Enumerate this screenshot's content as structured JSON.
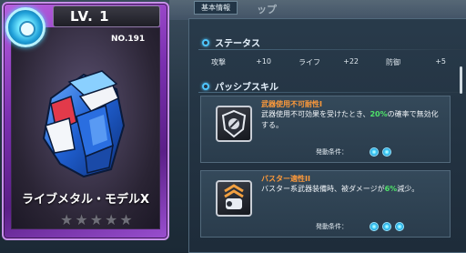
{
  "header": {
    "tab_label": "基本情報",
    "ghost_title": "ップ"
  },
  "card": {
    "level": "LV.  1",
    "number": "NO.191",
    "name": "ライブメタル・モデルX",
    "stars_total": 5,
    "stars_filled": 0,
    "frame_color": "#8a3ec6"
  },
  "status": {
    "heading": "ステータス",
    "items": [
      {
        "label": "攻撃",
        "value": "+10"
      },
      {
        "label": "ライフ",
        "value": "+22"
      },
      {
        "label": "防御",
        "value": "+5"
      }
    ]
  },
  "passive": {
    "heading": "パッシブスキル",
    "skills": [
      {
        "title": "武器使用不可耐性I",
        "desc_pre": "武器使用不可効果を受けたとき、",
        "desc_hl": "20%",
        "desc_post": "の確率で無効化する。",
        "cond_label": "発動条件：",
        "icon": "shield-icon"
      },
      {
        "title": "バスター適性II",
        "desc_pre": "バスター系武器装備時、被ダメージが",
        "desc_hl": "6%",
        "desc_post": "減少。",
        "cond_label": "発動条件：",
        "icon": "buster-icon"
      }
    ]
  },
  "colors": {
    "accent_orange": "#ff9a3a",
    "highlight_green": "#4fe26a",
    "cyan": "#4fc7ff"
  }
}
